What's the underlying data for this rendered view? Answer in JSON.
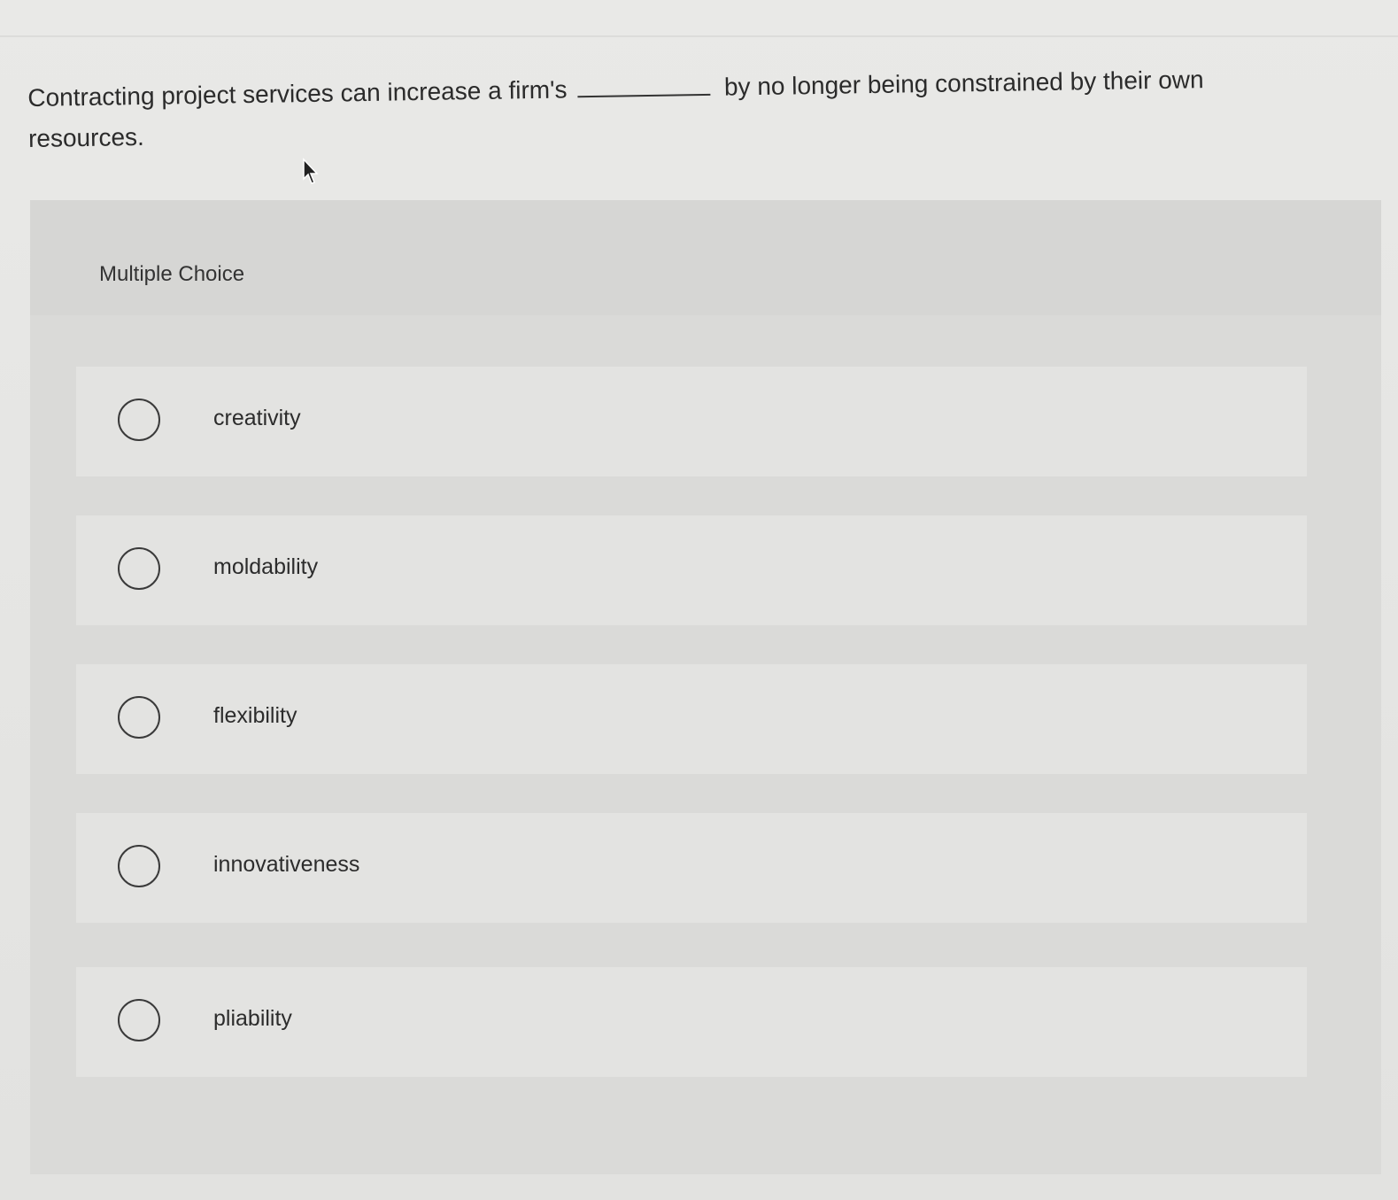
{
  "question": {
    "text_before": "Contracting project services can increase a firm's",
    "text_after": "by no longer being constrained by their own resources."
  },
  "section_label": "Multiple Choice",
  "options": [
    {
      "label": "creativity"
    },
    {
      "label": "moldability"
    },
    {
      "label": "flexibility"
    },
    {
      "label": "innovativeness"
    },
    {
      "label": "pliability"
    }
  ]
}
